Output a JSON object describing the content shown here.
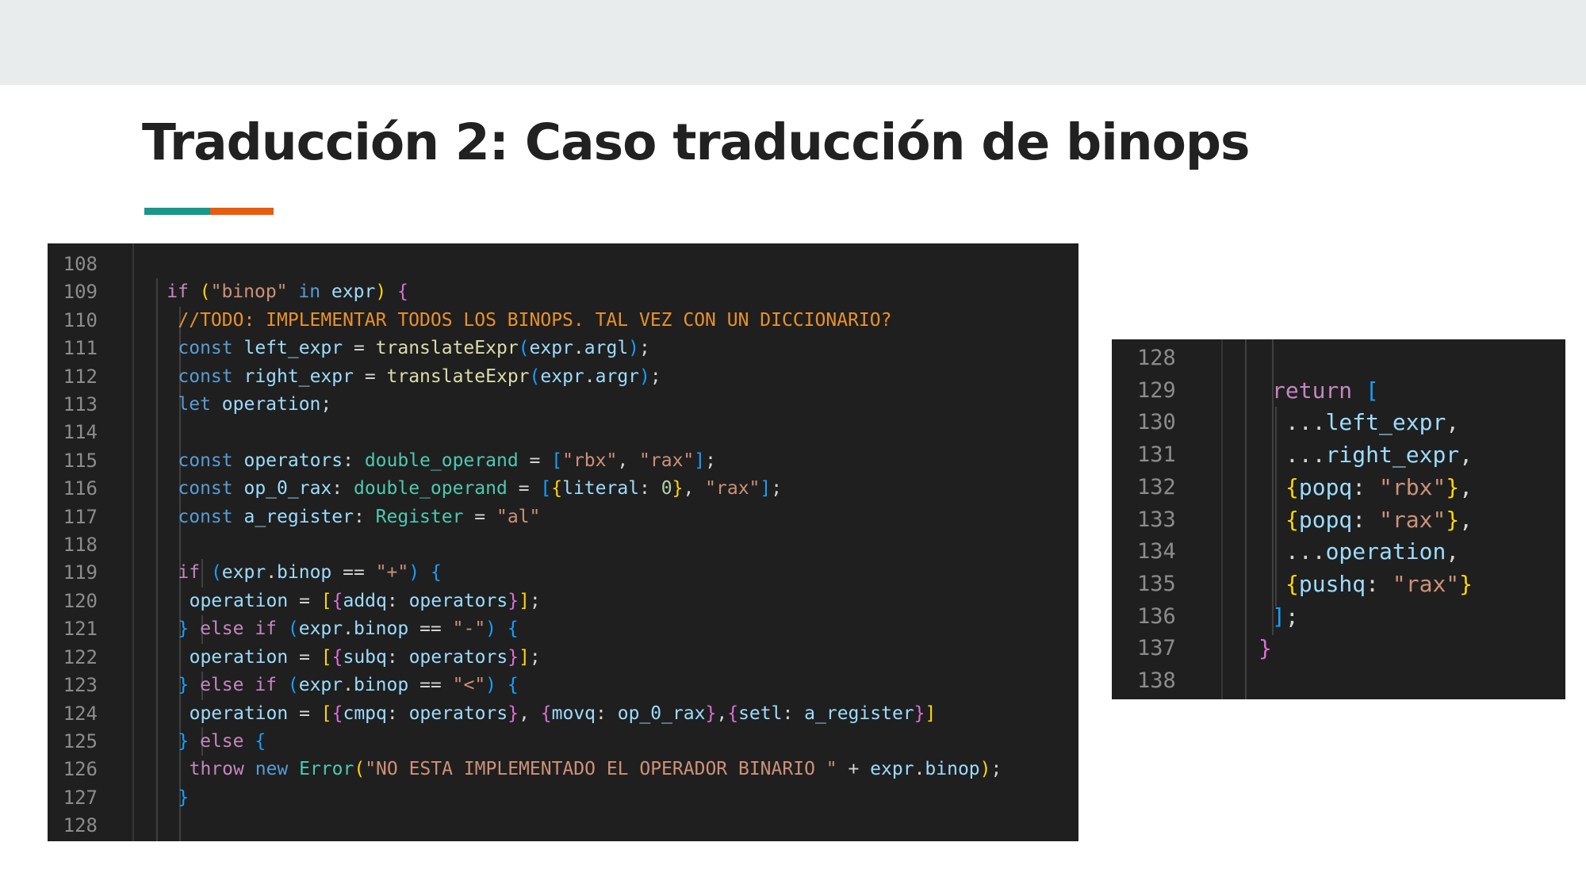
{
  "slide": {
    "title": "Traducción 2: Caso traducción de binops",
    "accent_colors": [
      "#16998b",
      "#ea5b0c"
    ],
    "background": "#ffffff",
    "top_band_color": "#e8ecec"
  },
  "editor_theme": {
    "background": "#1f1f1f",
    "line_number_color": "#8c8c8c",
    "keyword_color": "#c586c0",
    "storage_color": "#569cd6",
    "function_color": "#dcdcaa",
    "variable_color": "#9cdcfe",
    "string_color": "#ce9178",
    "type_color": "#4ec9b0",
    "comment_color": "#e8912d"
  },
  "code_left": {
    "line_numbers": [
      "108",
      "109",
      "110",
      "111",
      "112",
      "113",
      "114",
      "115",
      "116",
      "117",
      "118",
      "119",
      "120",
      "121",
      "122",
      "123",
      "124",
      "125",
      "126",
      "127",
      "128"
    ],
    "lines": [
      [],
      [
        {
          "t": "if ",
          "c": "kw"
        },
        {
          "t": "(",
          "c": "p1"
        },
        {
          "t": "\"binop\"",
          "c": "str"
        },
        {
          "t": " in ",
          "c": "st"
        },
        {
          "t": "expr",
          "c": "var"
        },
        {
          "t": ")",
          "c": "p1"
        },
        {
          "t": " ",
          "c": "pn"
        },
        {
          "t": "{",
          "c": "p2"
        }
      ],
      [
        {
          "t": "//TODO: IMPLEMENTAR TODOS LOS BINOPS. TAL VEZ CON UN DICCIONARIO?",
          "c": "cm"
        }
      ],
      [
        {
          "t": "const ",
          "c": "st"
        },
        {
          "t": "left_expr",
          "c": "var"
        },
        {
          "t": " = ",
          "c": "pn"
        },
        {
          "t": "translateExpr",
          "c": "fn"
        },
        {
          "t": "(",
          "c": "p3"
        },
        {
          "t": "expr",
          "c": "var"
        },
        {
          "t": ".",
          "c": "pn"
        },
        {
          "t": "argl",
          "c": "var"
        },
        {
          "t": ")",
          "c": "p3"
        },
        {
          "t": ";",
          "c": "pn"
        }
      ],
      [
        {
          "t": "const ",
          "c": "st"
        },
        {
          "t": "right_expr",
          "c": "var"
        },
        {
          "t": " = ",
          "c": "pn"
        },
        {
          "t": "translateExpr",
          "c": "fn"
        },
        {
          "t": "(",
          "c": "p3"
        },
        {
          "t": "expr",
          "c": "var"
        },
        {
          "t": ".",
          "c": "pn"
        },
        {
          "t": "argr",
          "c": "var"
        },
        {
          "t": ")",
          "c": "p3"
        },
        {
          "t": ";",
          "c": "pn"
        }
      ],
      [
        {
          "t": "let ",
          "c": "st"
        },
        {
          "t": "operation",
          "c": "var"
        },
        {
          "t": ";",
          "c": "pn"
        }
      ],
      [],
      [
        {
          "t": "const ",
          "c": "st"
        },
        {
          "t": "operators",
          "c": "var"
        },
        {
          "t": ": ",
          "c": "pn"
        },
        {
          "t": "double_operand",
          "c": "typ"
        },
        {
          "t": " = ",
          "c": "pn"
        },
        {
          "t": "[",
          "c": "p3"
        },
        {
          "t": "\"rbx\"",
          "c": "str"
        },
        {
          "t": ", ",
          "c": "pn"
        },
        {
          "t": "\"rax\"",
          "c": "str"
        },
        {
          "t": "]",
          "c": "p3"
        },
        {
          "t": ";",
          "c": "pn"
        }
      ],
      [
        {
          "t": "const ",
          "c": "st"
        },
        {
          "t": "op_0_rax",
          "c": "var"
        },
        {
          "t": ": ",
          "c": "pn"
        },
        {
          "t": "double_operand",
          "c": "typ"
        },
        {
          "t": " = ",
          "c": "pn"
        },
        {
          "t": "[",
          "c": "p3"
        },
        {
          "t": "{",
          "c": "p1"
        },
        {
          "t": "literal",
          "c": "var"
        },
        {
          "t": ": ",
          "c": "pn"
        },
        {
          "t": "0",
          "c": "num"
        },
        {
          "t": "}",
          "c": "p1"
        },
        {
          "t": ", ",
          "c": "pn"
        },
        {
          "t": "\"rax\"",
          "c": "str"
        },
        {
          "t": "]",
          "c": "p3"
        },
        {
          "t": ";",
          "c": "pn"
        }
      ],
      [
        {
          "t": "const ",
          "c": "st"
        },
        {
          "t": "a_register",
          "c": "var"
        },
        {
          "t": ": ",
          "c": "pn"
        },
        {
          "t": "Register",
          "c": "typ"
        },
        {
          "t": " = ",
          "c": "pn"
        },
        {
          "t": "\"al\"",
          "c": "str"
        }
      ],
      [],
      [
        {
          "t": "if ",
          "c": "kw"
        },
        {
          "t": "(",
          "c": "p3"
        },
        {
          "t": "expr",
          "c": "var"
        },
        {
          "t": ".",
          "c": "pn"
        },
        {
          "t": "binop",
          "c": "var"
        },
        {
          "t": " == ",
          "c": "pn"
        },
        {
          "t": "\"+\"",
          "c": "str"
        },
        {
          "t": ")",
          "c": "p3"
        },
        {
          "t": " ",
          "c": "pn"
        },
        {
          "t": "{",
          "c": "p3"
        }
      ],
      [
        {
          "t": "operation",
          "c": "var"
        },
        {
          "t": " = ",
          "c": "pn"
        },
        {
          "t": "[",
          "c": "p1"
        },
        {
          "t": "{",
          "c": "p2"
        },
        {
          "t": "addq",
          "c": "var"
        },
        {
          "t": ": ",
          "c": "pn"
        },
        {
          "t": "operators",
          "c": "var"
        },
        {
          "t": "}",
          "c": "p2"
        },
        {
          "t": "]",
          "c": "p1"
        },
        {
          "t": ";",
          "c": "pn"
        }
      ],
      [
        {
          "t": "}",
          "c": "p3"
        },
        {
          "t": " else if ",
          "c": "kw"
        },
        {
          "t": "(",
          "c": "p3"
        },
        {
          "t": "expr",
          "c": "var"
        },
        {
          "t": ".",
          "c": "pn"
        },
        {
          "t": "binop",
          "c": "var"
        },
        {
          "t": " == ",
          "c": "pn"
        },
        {
          "t": "\"-\"",
          "c": "str"
        },
        {
          "t": ")",
          "c": "p3"
        },
        {
          "t": " ",
          "c": "pn"
        },
        {
          "t": "{",
          "c": "p3"
        }
      ],
      [
        {
          "t": "operation",
          "c": "var"
        },
        {
          "t": " = ",
          "c": "pn"
        },
        {
          "t": "[",
          "c": "p1"
        },
        {
          "t": "{",
          "c": "p2"
        },
        {
          "t": "subq",
          "c": "var"
        },
        {
          "t": ": ",
          "c": "pn"
        },
        {
          "t": "operators",
          "c": "var"
        },
        {
          "t": "}",
          "c": "p2"
        },
        {
          "t": "]",
          "c": "p1"
        },
        {
          "t": ";",
          "c": "pn"
        }
      ],
      [
        {
          "t": "}",
          "c": "p3"
        },
        {
          "t": " else if ",
          "c": "kw"
        },
        {
          "t": "(",
          "c": "p3"
        },
        {
          "t": "expr",
          "c": "var"
        },
        {
          "t": ".",
          "c": "pn"
        },
        {
          "t": "binop",
          "c": "var"
        },
        {
          "t": " == ",
          "c": "pn"
        },
        {
          "t": "\"<\"",
          "c": "str"
        },
        {
          "t": ")",
          "c": "p3"
        },
        {
          "t": " ",
          "c": "pn"
        },
        {
          "t": "{",
          "c": "p3"
        }
      ],
      [
        {
          "t": "operation",
          "c": "var"
        },
        {
          "t": " = ",
          "c": "pn"
        },
        {
          "t": "[",
          "c": "p1"
        },
        {
          "t": "{",
          "c": "p2"
        },
        {
          "t": "cmpq",
          "c": "var"
        },
        {
          "t": ": ",
          "c": "pn"
        },
        {
          "t": "operators",
          "c": "var"
        },
        {
          "t": "}",
          "c": "p2"
        },
        {
          "t": ", ",
          "c": "pn"
        },
        {
          "t": "{",
          "c": "p2"
        },
        {
          "t": "movq",
          "c": "var"
        },
        {
          "t": ": ",
          "c": "pn"
        },
        {
          "t": "op_0_rax",
          "c": "var"
        },
        {
          "t": "}",
          "c": "p2"
        },
        {
          "t": ",",
          "c": "pn"
        },
        {
          "t": "{",
          "c": "p2"
        },
        {
          "t": "setl",
          "c": "var"
        },
        {
          "t": ": ",
          "c": "pn"
        },
        {
          "t": "a_register",
          "c": "var"
        },
        {
          "t": "}",
          "c": "p2"
        },
        {
          "t": "]",
          "c": "p1"
        }
      ],
      [
        {
          "t": "}",
          "c": "p3"
        },
        {
          "t": " else ",
          "c": "kw"
        },
        {
          "t": "{",
          "c": "p3"
        }
      ],
      [
        {
          "t": "throw ",
          "c": "kw"
        },
        {
          "t": "new ",
          "c": "st"
        },
        {
          "t": "Error",
          "c": "typ"
        },
        {
          "t": "(",
          "c": "p1"
        },
        {
          "t": "\"NO ESTA IMPLEMENTADO EL OPERADOR BINARIO \"",
          "c": "str"
        },
        {
          "t": " + ",
          "c": "pn"
        },
        {
          "t": "expr",
          "c": "var"
        },
        {
          "t": ".",
          "c": "pn"
        },
        {
          "t": "binop",
          "c": "var"
        },
        {
          "t": ")",
          "c": "p1"
        },
        {
          "t": ";",
          "c": "pn"
        }
      ],
      [
        {
          "t": "}",
          "c": "p3"
        }
      ],
      []
    ]
  },
  "code_right": {
    "line_numbers": [
      "128",
      "129",
      "130",
      "131",
      "132",
      "133",
      "134",
      "135",
      "136",
      "137",
      "138"
    ],
    "lines": [
      [],
      [
        {
          "t": "return ",
          "c": "kw"
        },
        {
          "t": "[",
          "c": "p3"
        }
      ],
      [
        {
          "t": "...",
          "c": "pn"
        },
        {
          "t": "left_expr",
          "c": "var"
        },
        {
          "t": ",",
          "c": "pn"
        }
      ],
      [
        {
          "t": "...",
          "c": "pn"
        },
        {
          "t": "right_expr",
          "c": "var"
        },
        {
          "t": ",",
          "c": "pn"
        }
      ],
      [
        {
          "t": "{",
          "c": "p1"
        },
        {
          "t": "popq",
          "c": "var"
        },
        {
          "t": ": ",
          "c": "pn"
        },
        {
          "t": "\"rbx\"",
          "c": "str"
        },
        {
          "t": "}",
          "c": "p1"
        },
        {
          "t": ",",
          "c": "pn"
        }
      ],
      [
        {
          "t": "{",
          "c": "p1"
        },
        {
          "t": "popq",
          "c": "var"
        },
        {
          "t": ": ",
          "c": "pn"
        },
        {
          "t": "\"rax\"",
          "c": "str"
        },
        {
          "t": "}",
          "c": "p1"
        },
        {
          "t": ",",
          "c": "pn"
        }
      ],
      [
        {
          "t": "...",
          "c": "pn"
        },
        {
          "t": "operation",
          "c": "var"
        },
        {
          "t": ",",
          "c": "pn"
        }
      ],
      [
        {
          "t": "{",
          "c": "p1"
        },
        {
          "t": "pushq",
          "c": "var"
        },
        {
          "t": ": ",
          "c": "pn"
        },
        {
          "t": "\"rax\"",
          "c": "str"
        },
        {
          "t": "}",
          "c": "p1"
        }
      ],
      [
        {
          "t": "]",
          "c": "p3"
        },
        {
          "t": ";",
          "c": "pn"
        }
      ],
      [
        {
          "t": "}",
          "c": "p2"
        }
      ],
      []
    ]
  }
}
